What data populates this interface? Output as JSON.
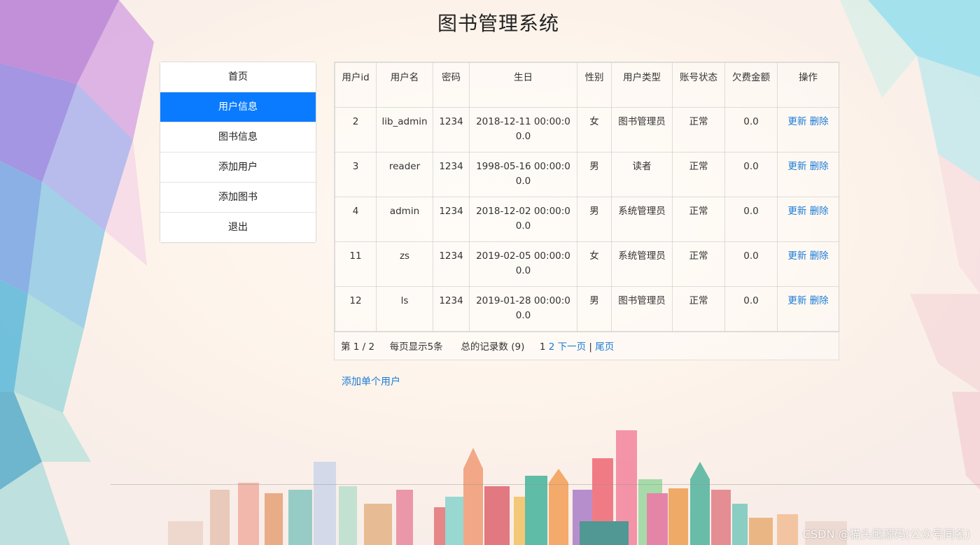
{
  "app": {
    "title": "图书管理系统"
  },
  "sidebar": {
    "items": [
      {
        "label": "首页",
        "active": false
      },
      {
        "label": "用户信息",
        "active": true
      },
      {
        "label": "图书信息",
        "active": false
      },
      {
        "label": "添加用户",
        "active": false
      },
      {
        "label": "添加图书",
        "active": false
      },
      {
        "label": "退出",
        "active": false
      }
    ]
  },
  "users_table": {
    "headers": [
      "用户id",
      "用户名",
      "密码",
      "生日",
      "性别",
      "用户类型",
      "账号状态",
      "欠费金额",
      "操作"
    ],
    "rows": [
      {
        "id": "2",
        "username": "lib_admin",
        "password": "1234",
        "birthday": "2018-12-11 00:00:00.0",
        "gender": "女",
        "type": "图书管理员",
        "status": "正常",
        "arrears": "0.0"
      },
      {
        "id": "3",
        "username": "reader",
        "password": "1234",
        "birthday": "1998-05-16 00:00:00.0",
        "gender": "男",
        "type": "读者",
        "status": "正常",
        "arrears": "0.0"
      },
      {
        "id": "4",
        "username": "admin",
        "password": "1234",
        "birthday": "2018-12-02 00:00:00.0",
        "gender": "男",
        "type": "系统管理员",
        "status": "正常",
        "arrears": "0.0"
      },
      {
        "id": "11",
        "username": "zs",
        "password": "1234",
        "birthday": "2019-02-05 00:00:00.0",
        "gender": "女",
        "type": "系统管理员",
        "status": "正常",
        "arrears": "0.0"
      },
      {
        "id": "12",
        "username": "ls",
        "password": "1234",
        "birthday": "2019-01-28 00:00:00.0",
        "gender": "男",
        "type": "图书管理员",
        "status": "正常",
        "arrears": "0.0"
      }
    ],
    "actions": {
      "update": "更新",
      "delete": "删除"
    }
  },
  "pagination": {
    "page_info": "第 1 / 2",
    "page_size": "每页显示5条",
    "total_label": "总的记录数",
    "total": "(9)",
    "current_page": "1",
    "next_page_number": "2",
    "next": "下一页",
    "separator": "|",
    "last": "尾页"
  },
  "add_single_user": "添加单个用户",
  "watermark": "CSDN @猫头鹰源码(公众号同名)",
  "colors": {
    "accent": "#0a7bff",
    "link": "#1c7bd6"
  }
}
